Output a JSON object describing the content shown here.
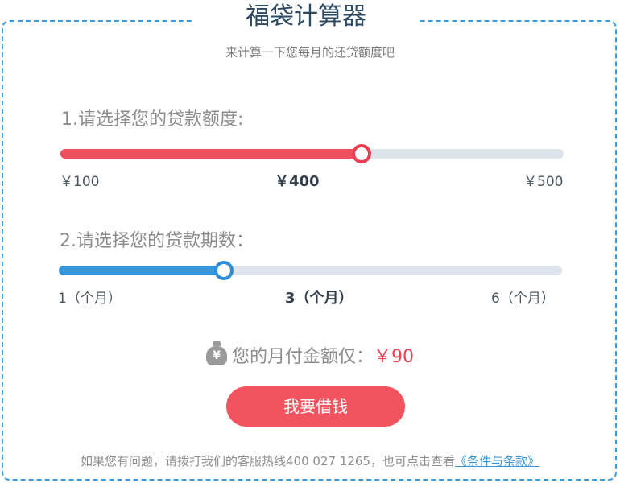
{
  "header": {
    "title": "福袋计算器",
    "subtitle": "来计算一下您每月的还贷额度吧"
  },
  "amount_slider": {
    "label": "1.请选择您的贷款额度:",
    "min_label": "￥100",
    "current_label": "￥400",
    "max_label": "￥500",
    "value": 400,
    "min": 100,
    "max": 500,
    "accent": "#f04f5e"
  },
  "term_slider": {
    "label": "2.请选择您的贷款期数：",
    "min_label": "1（个月）",
    "current_label": "3（个月）",
    "max_label": "6（个月）",
    "value": 3,
    "min": 1,
    "max": 6,
    "accent": "#3a95d8"
  },
  "result": {
    "icon": "money-bag-icon",
    "icon_glyph": "¥",
    "label": "您的月付金额仅：",
    "amount": "￥90"
  },
  "cta": {
    "label": "我要借钱"
  },
  "footer": {
    "text": "如果您有问题，请拨打我们的客服热线400  027 1265，也可点击查看",
    "link_text": "《条件与条款》"
  }
}
